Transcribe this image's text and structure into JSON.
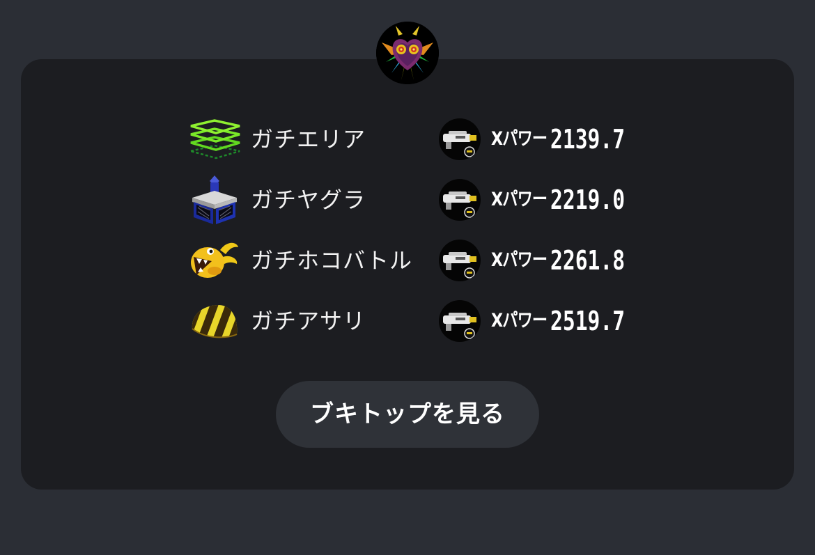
{
  "profile": {
    "avatar_icon": "majora-mask-icon"
  },
  "modes": [
    {
      "name": "ガチエリア",
      "icon": "splat-zones-icon",
      "weapon_icon": "weapon-icon",
      "xpower_label": "Xパワー",
      "xpower": "2139.7"
    },
    {
      "name": "ガチヤグラ",
      "icon": "tower-control-icon",
      "weapon_icon": "weapon-icon",
      "xpower_label": "Xパワー",
      "xpower": "2219.0"
    },
    {
      "name": "ガチホコバトル",
      "icon": "rainmaker-icon",
      "weapon_icon": "weapon-icon",
      "xpower_label": "Xパワー",
      "xpower": "2261.8"
    },
    {
      "name": "ガチアサリ",
      "icon": "clam-blitz-icon",
      "weapon_icon": "weapon-icon",
      "xpower_label": "Xパワー",
      "xpower": "2519.7"
    }
  ],
  "button": {
    "label": "ブキトップを見る"
  },
  "colors": {
    "background": "#2b2e35",
    "card": "#1c1d21",
    "button": "#2f3238",
    "text": "#ffffff"
  }
}
